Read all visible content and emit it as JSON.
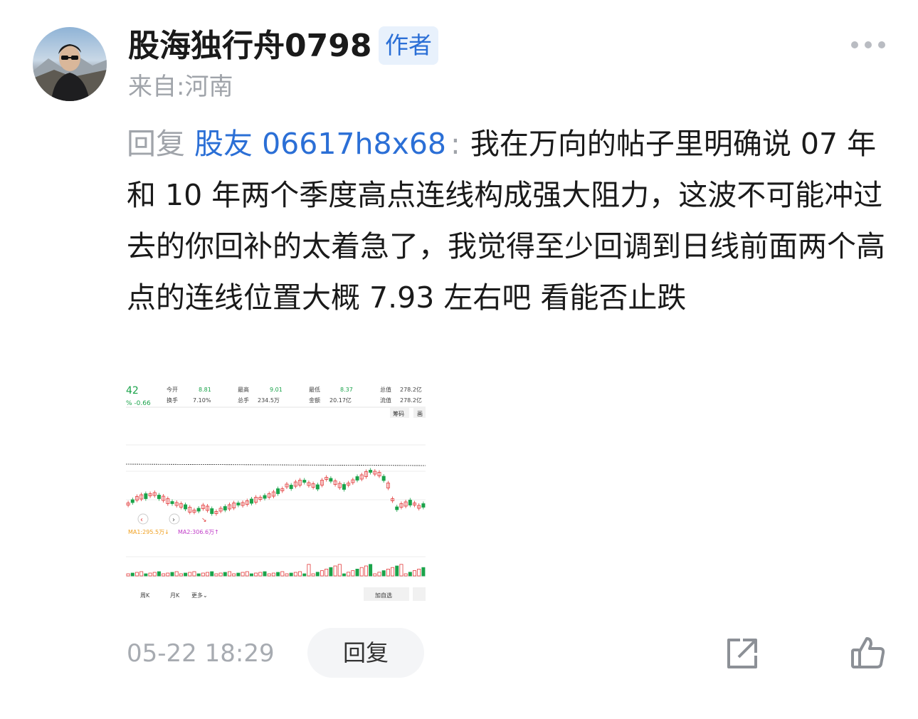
{
  "post": {
    "username": "股海独行舟0798",
    "badge": "作者",
    "location": "来自:河南",
    "reply_word": "回复",
    "mention": "股友 06617h8x68",
    "colon": ":",
    "text": "我在万向的帖子里明确说 07 年和 10 年两个季度高点连线构成强大阻力，这波不可能冲过去的你回补的太着急了，我觉得至少回调到日线前面两个高点的连线位置大概 7.93 左右吧  看能否止跌",
    "time": "05-22 18:29",
    "reply_button": "回复",
    "icons": {
      "avatar": "avatar-photo",
      "more": "more-dots-icon",
      "share": "share-icon",
      "like": "thumbs-up-icon"
    }
  },
  "quote_card": {
    "price_fragment": "42",
    "change_fragment": "% -0.66",
    "cells": [
      {
        "label": "今开",
        "value": "8.81"
      },
      {
        "label": "换手",
        "value": "7.10%"
      },
      {
        "label": "最高",
        "value": "9.01"
      },
      {
        "label": "总手",
        "value": "234.5万"
      },
      {
        "label": "最低",
        "value": "8.37"
      },
      {
        "label": "金额",
        "value": "20.17亿"
      },
      {
        "label": "总值",
        "value": "278.2亿"
      },
      {
        "label": "流值",
        "value": "278.2亿"
      }
    ],
    "small_btn_1": "筹码",
    "small_btn_2": "画",
    "ma1": "MA1:295.5万↓",
    "ma2": "MA2:306.6万↑",
    "tab_week": "周K",
    "tab_month": "月K",
    "tab_more": "更多⌄",
    "add_watch": "加自选",
    "colors": {
      "up": "#e23b3b",
      "down": "#1aa34a",
      "ma1": "#f0a020",
      "ma2": "#c03cc8"
    }
  }
}
